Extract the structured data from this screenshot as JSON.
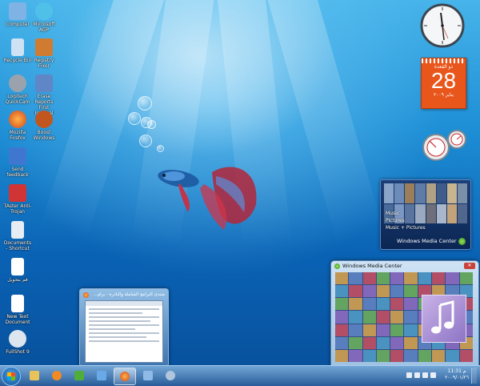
{
  "desktop_icons": [
    {
      "label": "Computer",
      "icon": "computer-icon",
      "color": "#7fb3e6"
    },
    {
      "label": "Microsoft AGP",
      "icon": "speech-bubble-icon",
      "color": "#4fc1e9"
    },
    {
      "label": "Recycle Bin",
      "icon": "recycle-bin-icon",
      "color": "#cfe2f3"
    },
    {
      "label": "Registry Fixer",
      "icon": "registry-icon",
      "color": "#d07b32"
    },
    {
      "label": "Logitech QuickCam",
      "icon": "webcam-icon",
      "color": "#9aa3ad"
    },
    {
      "label": "Erase Reports First Internal",
      "icon": "tools-icon",
      "color": "#5f86c7"
    },
    {
      "label": "Mozilla Firefox",
      "icon": "firefox-icon",
      "color": "#e4792b"
    },
    {
      "label": "Boost Windows",
      "icon": "boost-icon",
      "color": "#c2561f"
    },
    {
      "label": "Send feedback",
      "icon": "feedback-icon",
      "color": "#3f77d0"
    },
    {
      "label": "TAster Anti-Trojan",
      "icon": "anti-trojan-icon",
      "color": "#d03434"
    },
    {
      "label": "Documents - Shortcut",
      "icon": "documents-shortcut-icon",
      "color": "#e8edf4"
    },
    {
      "label": "قم بتحويل",
      "icon": "text-document-icon",
      "color": "#ffffff"
    },
    {
      "label": "New Text Document",
      "icon": "text-document-icon",
      "color": "#ffffff"
    },
    {
      "label": "FullShot 9",
      "icon": "camera-icon",
      "color": "#dde5ee"
    }
  ],
  "gadgets": {
    "calendar": {
      "month": "ذو القعدة",
      "day": "28",
      "year": "يناير ٢٠٠٩"
    },
    "media_center": {
      "menu": [
        "Music",
        "Pictures",
        "Music + Pictures"
      ],
      "brand": "Windows Media Center"
    }
  },
  "media_center_window": {
    "title": "Windows Media Center",
    "close_glyph": "✕"
  },
  "taskbar_preview": {
    "title": "منتدى البرامج الشاملة والنادرة - برام..."
  },
  "taskbar": {
    "buttons": [
      {
        "icon": "explorer-icon",
        "color": "#e8c35a"
      },
      {
        "icon": "media-player-icon",
        "color": "#f08a24"
      },
      {
        "icon": "windows-icon",
        "color": "#4fae3a"
      },
      {
        "icon": "document-icon",
        "color": "#6aa9e8"
      },
      {
        "icon": "firefox-icon",
        "color": "#e4792b",
        "active": true
      },
      {
        "icon": "window-icon",
        "color": "#8fb9e6"
      },
      {
        "icon": "settings-icon",
        "color": "#b0c6dd"
      }
    ],
    "clock": {
      "time": "11:31 م",
      "date": "٢٠٠٩/٠١/٢٦"
    }
  }
}
